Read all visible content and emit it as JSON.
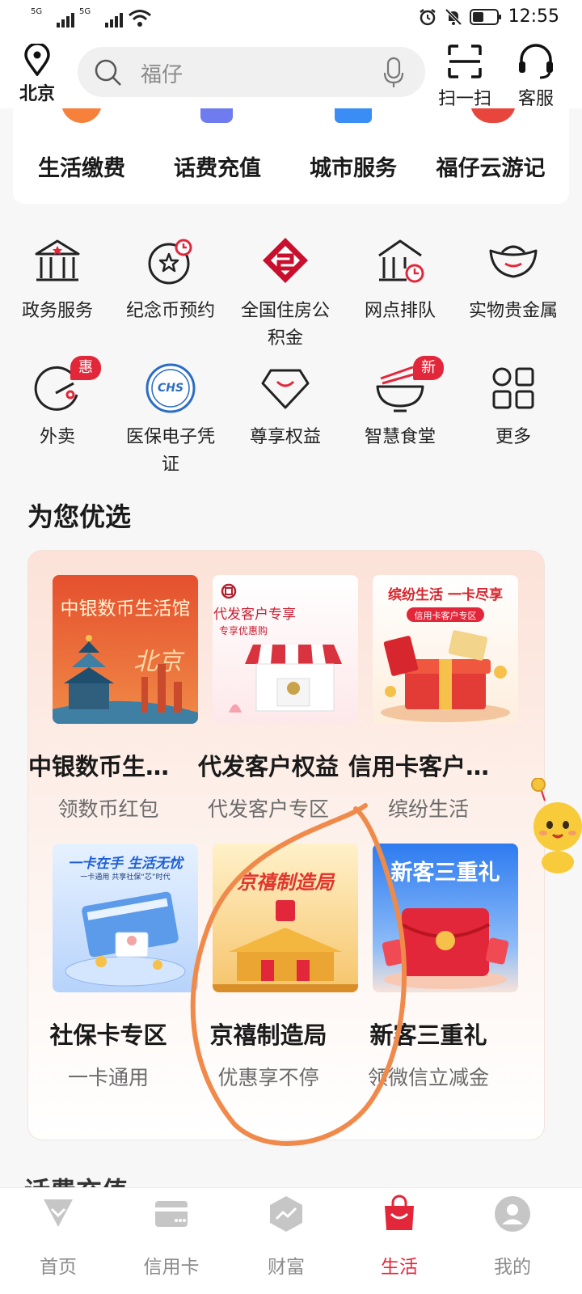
{
  "status_bar": {
    "sim1": "5G",
    "sim2": "5G",
    "time": "12:55"
  },
  "header": {
    "city": "北京",
    "search_placeholder": "福仔",
    "scan_label": "扫一扫",
    "service_label": "客服"
  },
  "top_services": [
    "生活缴费",
    "话费充值",
    "城市服务",
    "福仔云游记"
  ],
  "grid": {
    "items": [
      {
        "label": "政务服务",
        "icon": "government-icon"
      },
      {
        "label": "纪念币预约",
        "icon": "coin-clock-icon"
      },
      {
        "label": "全国住房公积金",
        "icon": "housing-fund-icon"
      },
      {
        "label": "网点排队",
        "icon": "branch-queue-icon"
      },
      {
        "label": "实物贵金属",
        "icon": "gold-ingot-icon"
      },
      {
        "label": "外卖",
        "icon": "takeout-icon",
        "badge": "惠"
      },
      {
        "label": "医保电子凭证",
        "icon": "chs-icon",
        "badge_text": "CHS"
      },
      {
        "label": "尊享权益",
        "icon": "diamond-icon"
      },
      {
        "label": "智慧食堂",
        "icon": "bowl-icon",
        "badge": "新"
      },
      {
        "label": "更多",
        "icon": "more-grid-icon"
      }
    ]
  },
  "recommend": {
    "title": "为您优选",
    "cards": [
      {
        "title": "中银数币生活馆",
        "subtitle": "领数币红包",
        "img_text": "中银数币生活馆",
        "img_text2": "北京"
      },
      {
        "title": "代发客户权益",
        "subtitle": "代发客户专区",
        "img_text": "代发客户专享",
        "img_text2": "专享优惠购"
      },
      {
        "title": "信用卡客户专区",
        "subtitle": "缤纷生活",
        "img_text": "缤纷生活 一卡尽享",
        "img_text2": "信用卡客户专区"
      },
      {
        "title": "社保卡专区",
        "subtitle": "一卡通用",
        "img_text": "一卡在手 生活无忧",
        "img_text2": "一卡通用 共享社保“芯”时代"
      },
      {
        "title": "京禧制造局",
        "subtitle": "优惠享不停",
        "img_text": "京禧制造局"
      },
      {
        "title": "新客三重礼",
        "subtitle": "领微信立减金",
        "img_text": "新客三重礼"
      }
    ]
  },
  "partial_section": "话费充值",
  "nav": {
    "items": [
      {
        "label": "首页"
      },
      {
        "label": "信用卡"
      },
      {
        "label": "财富"
      },
      {
        "label": "生活",
        "active": true
      },
      {
        "label": "我的"
      }
    ]
  },
  "colors": {
    "brand_red": "#e3273b",
    "annotation_orange": "#f08a4b"
  }
}
